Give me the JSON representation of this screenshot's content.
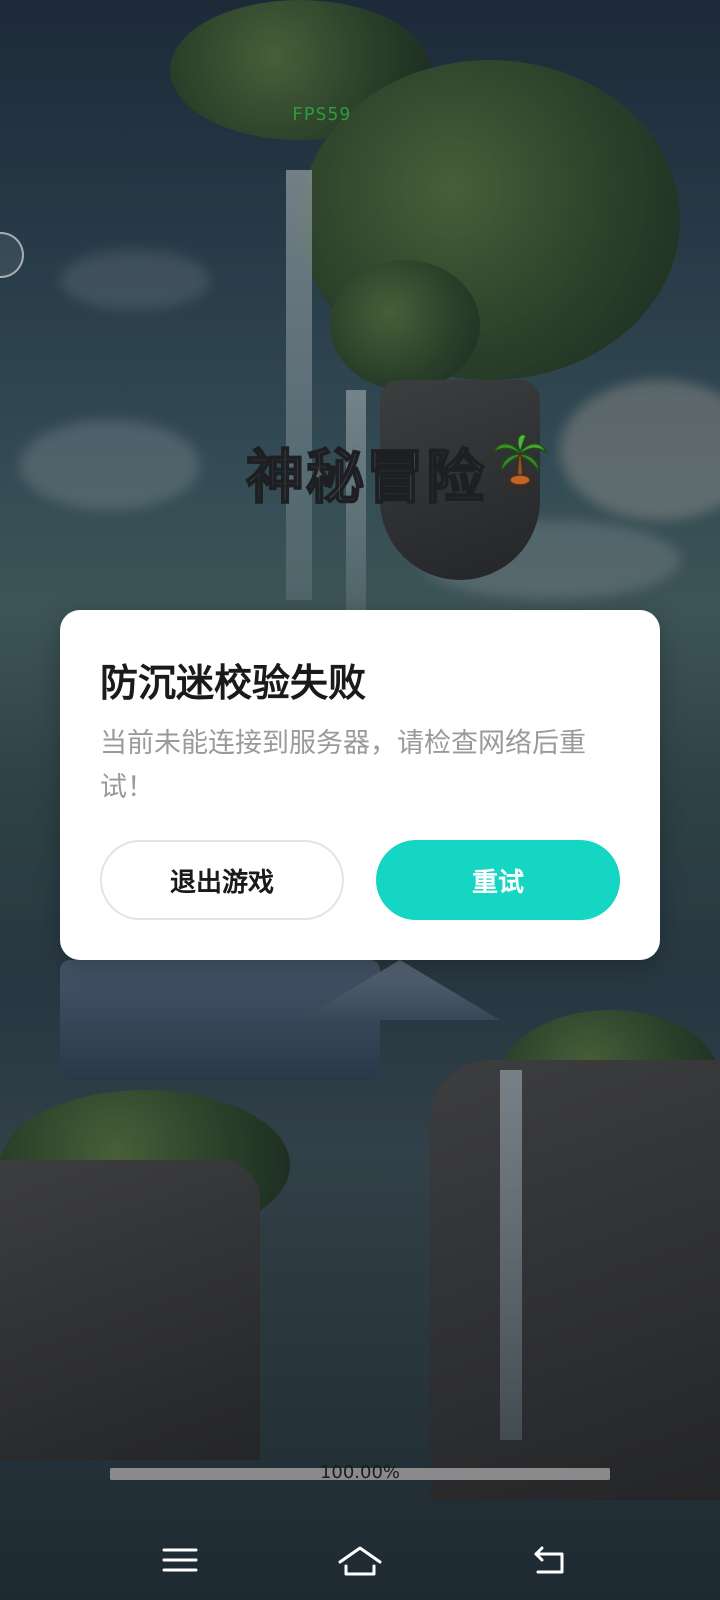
{
  "overlay": {
    "fps_label": "FPS59",
    "game_title": "神秘冒险",
    "title_icon": "palm-tree-icon"
  },
  "dialog": {
    "title": "防沉迷校验失败",
    "message": "当前未能连接到服务器，请检查网络后重试！",
    "exit_label": "退出游戏",
    "retry_label": "重试",
    "retry_color": "#15d6c2"
  },
  "loading": {
    "progress_text": "100.00%",
    "progress_value": 1.0
  },
  "nav": {
    "icons": [
      "menu-icon",
      "home-icon",
      "back-icon"
    ]
  }
}
